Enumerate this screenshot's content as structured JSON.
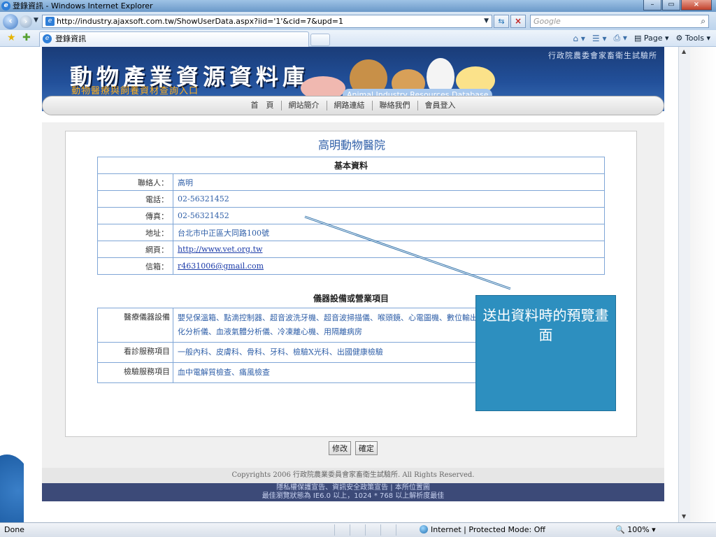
{
  "window": {
    "title": "登錄資訊 - Windows Internet Explorer",
    "tab_label": "登錄資訊",
    "url": "http://industry.ajaxsoft.com.tw/ShowUserData.aspx?iid='1'&cid=7&upd=1",
    "search_placeholder": "Google",
    "cmd_page": "Page",
    "cmd_tools": "Tools"
  },
  "banner": {
    "agency": "行政院農委會家畜衛生試驗所",
    "title": "動物產業資源資料庫",
    "subtitle": "動物醫療與飼養資材查詢入口",
    "english": "Animal Industry Resources Database"
  },
  "menu": [
    "首　頁",
    "網站簡介",
    "網路連結",
    "聯絡我們",
    "會員登入"
  ],
  "org": {
    "name": "高明動物醫院"
  },
  "basic": {
    "header": "基本資料",
    "rows": [
      {
        "label": "聯絡人：",
        "value": "高明"
      },
      {
        "label": "電話：",
        "value": "02-56321452"
      },
      {
        "label": "傳真：",
        "value": "02-56321452"
      },
      {
        "label": "地址：",
        "value": "台北市中正區大同路100號"
      },
      {
        "label": "網頁：",
        "value": "http://www.vet.org.tw"
      },
      {
        "label": "信箱：",
        "value": "r4631006@gmail.com"
      }
    ]
  },
  "equipment": {
    "header": "儀器設備或營業項目",
    "rows": [
      {
        "label": "醫療儀器設備",
        "value": "嬰兒保溫箱、點滴控制器、超音波洗牙機、超音波掃描儀、喉頭鏡、心電圖機、數位輸出系統、顯微鏡及攝影系統、血液生化分析儀、血液氣體分析儀、冷凍離心機、用隔離病房"
      },
      {
        "label": "看診服務項目",
        "value": "一般內科、皮膚科、骨科、牙科、檢驗X光科、出國健康檢驗"
      },
      {
        "label": "檢驗服務項目",
        "value": "血中電解質檢查、痛風檢查"
      }
    ]
  },
  "buttons": {
    "modify": "修改",
    "confirm": "確定"
  },
  "footer": {
    "copyright": "Copyrights 2006 行政院農業委員會家畜衛生試驗所. All Rights Reserved.",
    "links": "隱私權保護宣告、資訊安全政策宣告 | 本所位置圖",
    "browser_note": "最佳瀏覽狀態為 IE6.0 以上，1024 * 768 以上解析度最佳"
  },
  "callout": {
    "text": "送出資料時的預覽畫面"
  },
  "status": {
    "left": "Done",
    "zone": "Internet | Protected Mode: Off",
    "zoom": "100%"
  },
  "colors": {
    "banner_blue": "#1a3c78",
    "link_blue": "#2f5fa8",
    "callout_teal": "#2d8fbf",
    "footer_navy": "#3c4a78"
  }
}
